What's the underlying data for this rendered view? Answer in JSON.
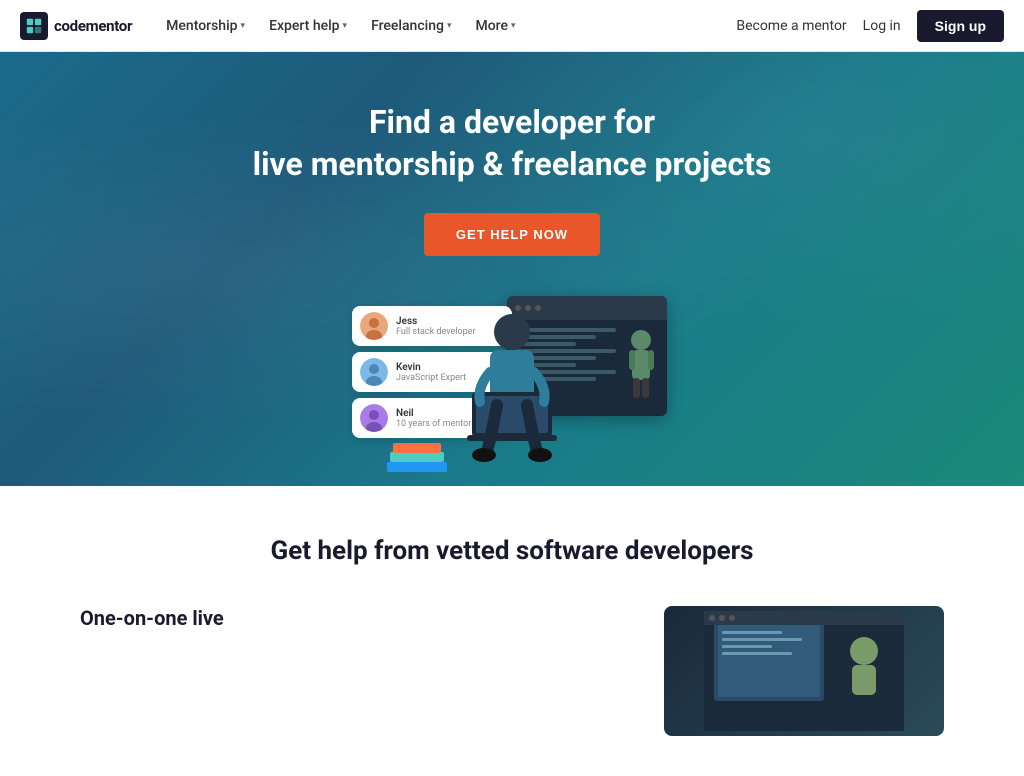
{
  "logo": {
    "text": "codementor"
  },
  "navbar": {
    "items": [
      {
        "label": "Mentorship",
        "hasDropdown": true
      },
      {
        "label": "Expert help",
        "hasDropdown": true
      },
      {
        "label": "Freelancing",
        "hasDropdown": true
      },
      {
        "label": "More",
        "hasDropdown": true
      }
    ],
    "actions": {
      "become_mentor": "Become a mentor",
      "login": "Log in",
      "signup": "Sign up"
    }
  },
  "hero": {
    "title_line1": "Find a developer for",
    "title_line2": "live mentorship & freelance projects",
    "cta": "GET HELP NOW"
  },
  "developers": [
    {
      "name": "Jess",
      "role": "Full stack developer",
      "color": "#e8a87c"
    },
    {
      "name": "Kevin",
      "role": "JavaScript Expert",
      "color": "#7cb8e8"
    },
    {
      "name": "Neil",
      "role": "10 years of mentorship",
      "color": "#a87ce8"
    }
  ],
  "lower": {
    "section_title": "Get help from vetted software developers",
    "feature_heading": "One-on-one live"
  }
}
